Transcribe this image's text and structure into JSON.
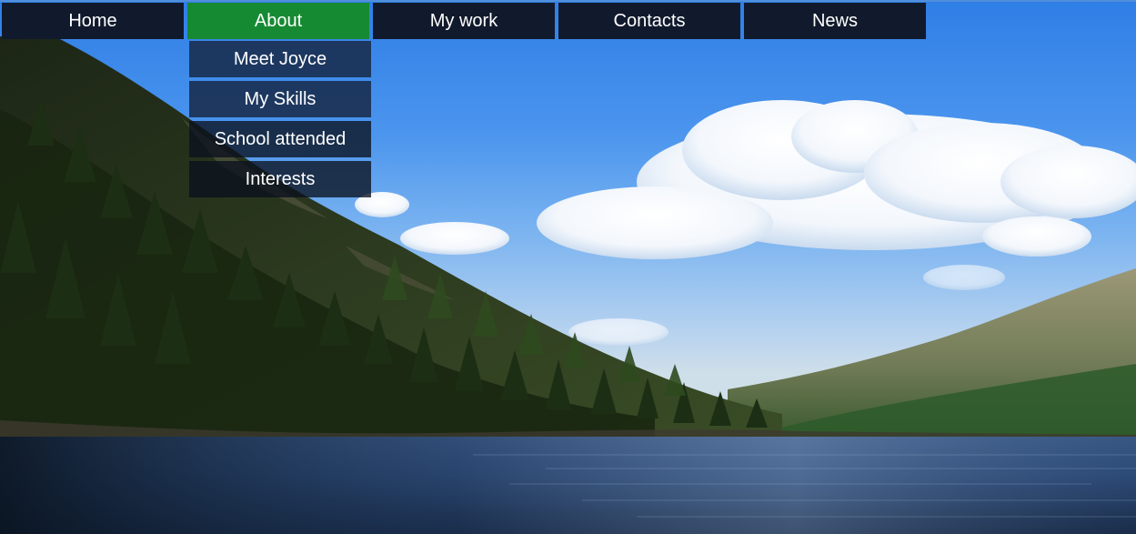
{
  "nav": {
    "items": [
      {
        "label": "Home"
      },
      {
        "label": "About",
        "active": true
      },
      {
        "label": "My work"
      },
      {
        "label": "Contacts"
      },
      {
        "label": "News"
      }
    ],
    "active_color": "#168a33",
    "item_color": "#111a2c"
  },
  "dropdown": {
    "items": [
      {
        "label": "Meet Joyce"
      },
      {
        "label": "My Skills"
      },
      {
        "label": "School attended"
      },
      {
        "label": "Interests"
      }
    ]
  },
  "background": {
    "description_icon": "landscape-photo"
  }
}
